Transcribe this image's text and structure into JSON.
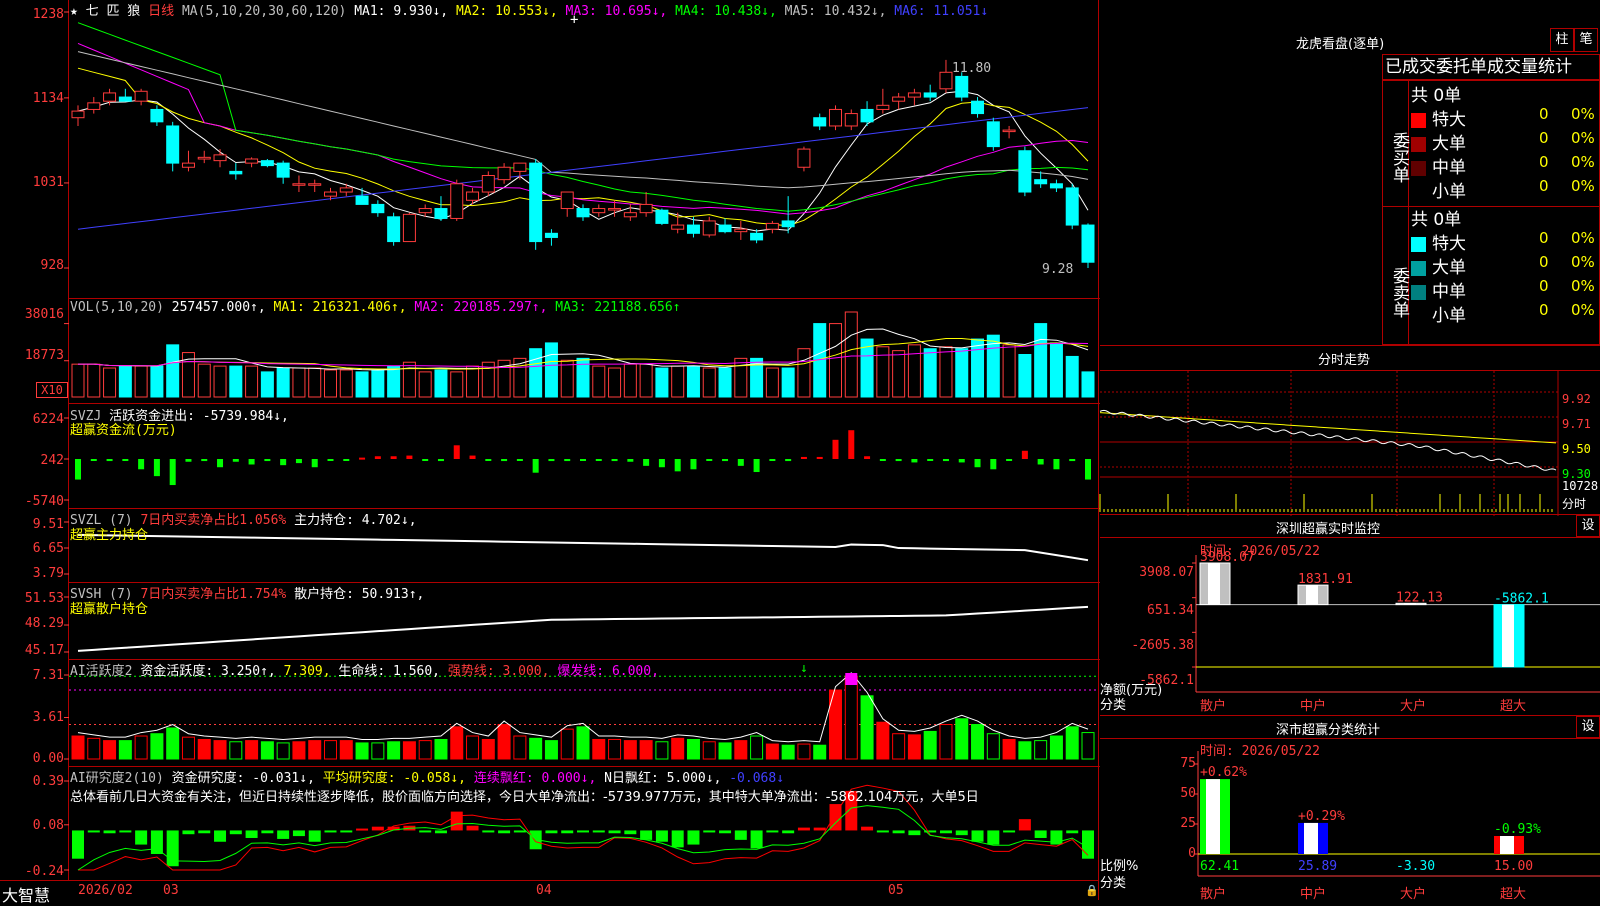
{
  "kline": {
    "header": {
      "star": "★",
      "name_chars": "七 匹 狼",
      "period": "日线",
      "ma_title": "MA(5,10,20,30,60,120)",
      "ma1": "MA1: 9.930↓,",
      "ma2": "MA2: 10.553↓,",
      "ma3": "MA3: 10.695↓,",
      "ma4": "MA4: 10.438↓,",
      "ma5": "MA5: 10.432↓,",
      "ma6": "MA6: 11.051↓"
    },
    "y_labels": [
      "1238",
      "1134",
      "1031",
      "928"
    ],
    "high_label": "11.80",
    "low_label": "9.28"
  },
  "vol": {
    "header": {
      "title": "VOL(5,10,20)",
      "value": "257457.000↑,",
      "ma1": "MA1: 216321.406↑,",
      "ma2": "MA2: 220185.297↑,",
      "ma3": "MA3: 221188.656↑"
    },
    "y_labels": [
      "38016",
      "18773"
    ],
    "unit": "X10"
  },
  "svzj": {
    "header": {
      "title": "SVZJ",
      "label": "活跃资金进出: -5739.984↓,",
      "sub": "超赢资金流(万元)"
    },
    "y_labels": [
      "6224",
      "242",
      "-5740"
    ]
  },
  "svzl": {
    "header": {
      "title": "SVZL (7)",
      "ratio": "7日内买卖净占比1.056%",
      "hold": "主力持仓: 4.702↓,",
      "sub": "超赢主力持仓"
    },
    "y_labels": [
      "9.51",
      "6.65",
      "3.79"
    ]
  },
  "svsh": {
    "header": {
      "title": "SVSH (7)",
      "ratio": "7日内买卖净占比1.754%",
      "hold": "散户持仓: 50.913↑,",
      "sub": "超赢散户持仓"
    },
    "y_labels": [
      "51.53",
      "48.29",
      "45.17"
    ]
  },
  "ai1": {
    "header": {
      "title": "AI活跃度2",
      "act": "资金活跃度: 3.250↑,",
      "v2": "7.309,",
      "life": "生命线: 1.560,",
      "strong": "强势线: 3.000,",
      "burst": "爆发线: 6.000,"
    },
    "y_labels": [
      "7.31",
      "3.61",
      "0.00"
    ]
  },
  "ai2": {
    "header": {
      "title": "AI研究度2(10)",
      "res": "资金研究度: -0.031↓,",
      "avg": "平均研究度: -0.058↓,",
      "red": "连续飘红: 0.000↓,",
      "nred": "N日飘红: 5.000↓,",
      "last": "-0.068↓"
    },
    "comment": "总体看前几日大资金有关注，但近日持续性逐步降低，股价面临方向选择，今日大单净流出：-5739.977万元，其中特大单净流出：-5862.104万元，大单5日",
    "y_labels": [
      "0.39",
      "0.08",
      "-0.24"
    ]
  },
  "bottom": {
    "brand": "大智慧",
    "date": "2026/02",
    "m1": "03",
    "m2": "04",
    "m3": "05"
  },
  "lhb": {
    "title": "龙虎看盘(逐单)",
    "btn1": "柱",
    "btn2": "笔",
    "tabs": "已成交委托单成交量统计",
    "buy": {
      "side": "委买单",
      "total": "共 0单",
      "rows": [
        {
          "label": "特大",
          "color": "#ff0000",
          "v": "0",
          "p": "0%"
        },
        {
          "label": "大单",
          "color": "#a00000",
          "v": "0",
          "p": "0%"
        },
        {
          "label": "中单",
          "color": "#600000",
          "v": "0",
          "p": "0%"
        },
        {
          "label": "小单",
          "color": "#000000",
          "v": "0",
          "p": "0%"
        }
      ]
    },
    "sell": {
      "side": "委卖单",
      "total": "共 0单",
      "rows": [
        {
          "label": "特大",
          "color": "#00ffff",
          "v": "0",
          "p": "0%"
        },
        {
          "label": "大单",
          "color": "#00a0a0",
          "v": "0",
          "p": "0%"
        },
        {
          "label": "中单",
          "color": "#008080",
          "v": "0",
          "p": "0%"
        },
        {
          "label": "小单",
          "color": "#000000",
          "v": "0",
          "p": "0%"
        }
      ]
    }
  },
  "fenshi": {
    "title": "分时走势",
    "y_labels": [
      "9.92",
      "9.71",
      "9.50",
      "9.30"
    ],
    "vol_label": "10728",
    "unit": "分时"
  },
  "szjk": {
    "title": "深圳超赢实时监控",
    "btn": "设",
    "time": "时间: 2026/05/22",
    "y_labels": [
      "3908.07",
      "651.34",
      "-2605.38",
      "-5862.1"
    ],
    "ylabel1": "净额(万元)",
    "ylabel2": "分类",
    "cats": [
      "散户",
      "中户",
      "大户",
      "超大"
    ],
    "bars": [
      {
        "v": 3908.07,
        "label": "3908.07"
      },
      {
        "v": 1831.91,
        "label": "1831.91"
      },
      {
        "v": 122.13,
        "label": "122.13"
      },
      {
        "v": -5862.1,
        "label": "-5862.1"
      }
    ]
  },
  "szfl": {
    "title": "深市超赢分类统计",
    "btn": "设",
    "time": "时间: 2026/05/22",
    "y_labels": [
      "75",
      "50",
      "25",
      "0"
    ],
    "ylabel1": "比例%",
    "ylabel2": "分类",
    "cats": [
      "散户",
      "中户",
      "大户",
      "超大"
    ],
    "bars": [
      {
        "v": 62.41,
        "chg": "+0.62%",
        "val": "62.41",
        "color": "#00ff00"
      },
      {
        "v": 25.89,
        "chg": "+0.29%",
        "val": "25.89",
        "color": "#0000ff"
      },
      {
        "v": 0,
        "chg": "",
        "val": "-3.30",
        "color": "#00ffff"
      },
      {
        "v": 15.0,
        "chg": "-0.93%",
        "val": "15.00",
        "color": "#ff0000"
      }
    ]
  },
  "chart_data": {
    "type": "candlestick",
    "series": [
      {
        "name": "K线",
        "ohlc": [
          [
            11.1,
            11.25,
            11.0,
            11.18
          ],
          [
            11.2,
            11.35,
            11.15,
            11.28
          ],
          [
            11.3,
            11.45,
            11.25,
            11.4
          ],
          [
            11.35,
            11.45,
            11.3,
            11.3
          ],
          [
            11.3,
            11.45,
            11.25,
            11.42
          ],
          [
            11.2,
            11.25,
            11.0,
            11.05
          ],
          [
            11.0,
            11.05,
            10.45,
            10.55
          ],
          [
            10.5,
            10.7,
            10.45,
            10.55
          ],
          [
            10.6,
            10.7,
            10.55,
            10.62
          ],
          [
            10.58,
            10.72,
            10.5,
            10.65
          ],
          [
            10.45,
            10.55,
            10.35,
            10.42
          ],
          [
            10.55,
            10.62,
            10.5,
            10.6
          ],
          [
            10.58,
            10.6,
            10.5,
            10.52
          ],
          [
            10.55,
            10.58,
            10.3,
            10.38
          ],
          [
            10.3,
            10.4,
            10.2,
            10.3
          ],
          [
            10.3,
            10.35,
            10.2,
            10.3
          ],
          [
            10.15,
            10.25,
            10.1,
            10.2
          ],
          [
            10.2,
            10.3,
            10.15,
            10.25
          ],
          [
            10.15,
            10.25,
            10.05,
            10.05
          ],
          [
            10.05,
            10.1,
            9.9,
            9.95
          ],
          [
            9.9,
            9.95,
            9.55,
            9.6
          ],
          [
            9.6,
            9.95,
            9.6,
            9.93
          ],
          [
            9.95,
            10.05,
            9.9,
            10.0
          ],
          [
            10.0,
            10.15,
            9.85,
            9.88
          ],
          [
            9.88,
            10.35,
            9.85,
            10.3
          ],
          [
            10.1,
            10.25,
            10.05,
            10.2
          ],
          [
            10.2,
            10.45,
            10.15,
            10.4
          ],
          [
            10.35,
            10.55,
            10.3,
            10.5
          ],
          [
            10.45,
            10.55,
            10.35,
            10.55
          ],
          [
            10.55,
            10.6,
            9.5,
            9.6
          ],
          [
            9.7,
            9.75,
            9.55,
            9.65
          ],
          [
            10.0,
            10.2,
            9.9,
            10.2
          ],
          [
            10.0,
            10.05,
            9.85,
            9.9
          ],
          [
            9.95,
            10.05,
            9.9,
            10.0
          ],
          [
            10.0,
            10.1,
            9.9,
            10.0
          ],
          [
            9.9,
            10.05,
            9.85,
            9.95
          ],
          [
            9.95,
            10.2,
            9.9,
            10.05
          ],
          [
            9.98,
            10.0,
            9.8,
            9.82
          ],
          [
            9.75,
            9.95,
            9.7,
            9.8
          ],
          [
            9.8,
            9.9,
            9.65,
            9.7
          ],
          [
            9.68,
            9.9,
            9.65,
            9.85
          ],
          [
            9.8,
            9.88,
            9.7,
            9.72
          ],
          [
            9.72,
            9.85,
            9.62,
            9.75
          ],
          [
            9.7,
            9.75,
            9.58,
            9.62
          ],
          [
            9.75,
            9.85,
            9.7,
            9.82
          ],
          [
            9.85,
            10.15,
            9.7,
            9.78
          ],
          [
            10.5,
            10.75,
            10.45,
            10.72
          ],
          [
            11.1,
            11.15,
            10.95,
            11.0
          ],
          [
            11.0,
            11.25,
            10.95,
            11.2
          ],
          [
            11.0,
            11.2,
            10.95,
            11.15
          ],
          [
            11.2,
            11.3,
            11.0,
            11.05
          ],
          [
            11.2,
            11.45,
            11.15,
            11.25
          ],
          [
            11.3,
            11.4,
            11.2,
            11.35
          ],
          [
            11.35,
            11.45,
            11.25,
            11.4
          ],
          [
            11.4,
            11.5,
            11.3,
            11.35
          ],
          [
            11.45,
            11.8,
            11.4,
            11.65
          ],
          [
            11.6,
            11.65,
            11.3,
            11.35
          ],
          [
            11.3,
            11.35,
            11.1,
            11.15
          ],
          [
            11.05,
            11.1,
            10.7,
            10.75
          ],
          [
            10.95,
            11.0,
            10.85,
            10.95
          ],
          [
            10.7,
            10.75,
            10.15,
            10.2
          ],
          [
            10.35,
            10.45,
            10.25,
            10.3
          ],
          [
            10.3,
            10.35,
            10.2,
            10.25
          ],
          [
            10.25,
            10.3,
            9.75,
            9.8
          ],
          [
            9.8,
            9.82,
            9.28,
            9.35
          ]
        ]
      },
      {
        "name": "VOL",
        "values": [
          17,
          17,
          15,
          16,
          16,
          16,
          27,
          23,
          17,
          16,
          16,
          16,
          13,
          15,
          15,
          15,
          14,
          14,
          13,
          14,
          16,
          18,
          13,
          14,
          13,
          16,
          18,
          19,
          20,
          25,
          28,
          19,
          20,
          16,
          15,
          17,
          17,
          15,
          16,
          16,
          15,
          15,
          20,
          20,
          15,
          15,
          25,
          38,
          38,
          44,
          30,
          26,
          24,
          27,
          25,
          26,
          25,
          30,
          32,
          27,
          22,
          38,
          28,
          21,
          13
        ]
      },
      {
        "name": "SVZJ",
        "values": [
          -3000,
          -200,
          -300,
          -200,
          -1500,
          -2500,
          -3800,
          -400,
          -300,
          -1200,
          -400,
          -800,
          -300,
          -900,
          -600,
          -1200,
          0,
          -200,
          200,
          400,
          400,
          500,
          0,
          -300,
          2000,
          500,
          0,
          -300,
          -200,
          -2000,
          -300,
          -300,
          -200,
          -200,
          -300,
          -400,
          -1000,
          -1200,
          -1800,
          -1500,
          -200,
          -300,
          -1000,
          -1900,
          -200,
          -300,
          300,
          300,
          2800,
          4200,
          400,
          -200,
          -300,
          -500,
          -200,
          -300,
          -500,
          -1200,
          -1500,
          -200,
          1200,
          -800,
          -1500,
          -300,
          -3000,
          -5740
        ]
      },
      {
        "name": "AI活跃度",
        "values": [
          2.0,
          1.8,
          1.6,
          1.6,
          2.0,
          2.2,
          2.7,
          1.9,
          1.7,
          1.6,
          1.5,
          1.6,
          1.5,
          1.4,
          1.5,
          1.6,
          1.6,
          1.6,
          1.4,
          1.4,
          1.5,
          1.5,
          1.6,
          1.7,
          2.8,
          2.0,
          1.7,
          3.0,
          2.0,
          1.8,
          1.6,
          2.6,
          2.8,
          1.7,
          1.7,
          1.6,
          1.6,
          1.5,
          1.8,
          1.7,
          1.5,
          1.4,
          1.6,
          2.0,
          1.3,
          1.2,
          1.3,
          1.2,
          6.0,
          7.2,
          5.5,
          3.2,
          2.2,
          2.1,
          2.4,
          3.0,
          3.5,
          3.0,
          2.2,
          1.7,
          1.5,
          1.6,
          2.0,
          2.8,
          2.3,
          3.3
        ]
      }
    ]
  }
}
